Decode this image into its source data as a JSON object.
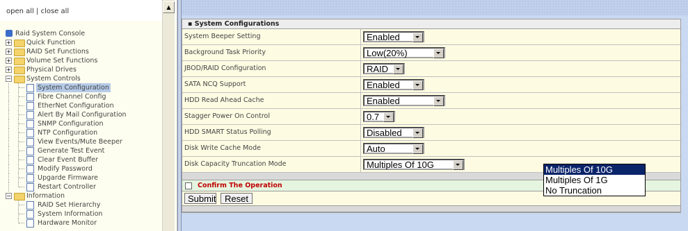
{
  "left": {
    "open_all": "open all",
    "separator": "|",
    "close_all": "close all",
    "tree": [
      {
        "label": "Raid System Console"
      },
      {
        "label": "Quick Function"
      },
      {
        "label": "RAID Set Functions"
      },
      {
        "label": "Volume Set Functions"
      },
      {
        "label": "Physical Drives"
      },
      {
        "label": "System Controls"
      },
      {
        "label": "System Configuration"
      },
      {
        "label": "Fibre Channel Config"
      },
      {
        "label": "EtherNet Configuration"
      },
      {
        "label": "Alert By Mail Configuration"
      },
      {
        "label": "SNMP Configuration"
      },
      {
        "label": "NTP Configuration"
      },
      {
        "label": "View Events/Mute Beeper"
      },
      {
        "label": "Generate Test Event"
      },
      {
        "label": "Clear Event Buffer"
      },
      {
        "label": "Modify Password"
      },
      {
        "label": "Upgarde Firmware"
      },
      {
        "label": "Restart Controller"
      },
      {
        "label": "Information"
      },
      {
        "label": "RAID Set Hierarchy"
      },
      {
        "label": "System Information"
      },
      {
        "label": "Hardware Monitor"
      }
    ]
  },
  "panel": {
    "title": "System Configurations",
    "rows": [
      {
        "label": "System Beeper Setting",
        "value": "Enabled"
      },
      {
        "label": "Background Task Priority",
        "value": "Low(20%)"
      },
      {
        "label": "JBOD/RAID Configuration",
        "value": "RAID"
      },
      {
        "label": "SATA NCQ Support",
        "value": "Enabled"
      },
      {
        "label": "HDD Read Ahead Cache",
        "value": "Enabled"
      },
      {
        "label": "Stagger Power On Control",
        "value": "0.7"
      },
      {
        "label": "HDD SMART Status Polling",
        "value": "Disabled"
      },
      {
        "label": "Disk Write Cache Mode",
        "value": "Auto"
      },
      {
        "label": "Disk Capacity Truncation Mode",
        "value": "Multiples Of 10G"
      }
    ],
    "confirm_label": "Confirm The Operation",
    "submit_label": "Submit",
    "reset_label": "Reset"
  },
  "dropdown": {
    "options": [
      "Multiples Of 10G",
      "Multiples Of 1G",
      "No Truncation"
    ],
    "highlighted": "Multiples Of 10G"
  }
}
